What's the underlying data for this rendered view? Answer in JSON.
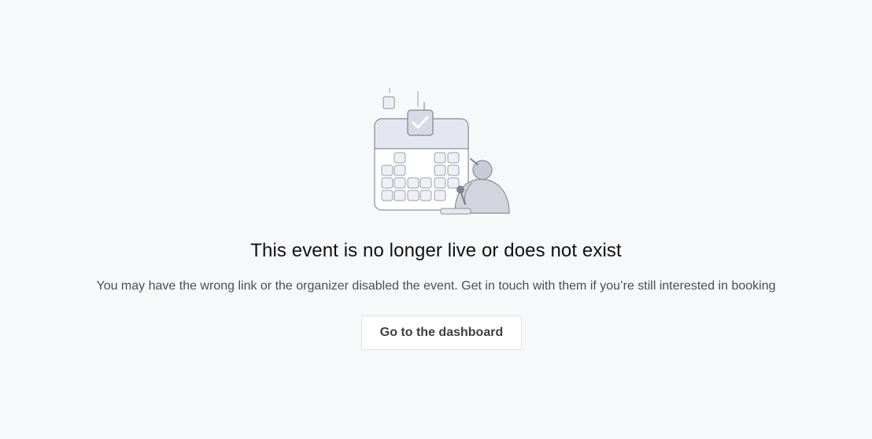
{
  "empty_state": {
    "illustration_icon": "calendar-check-illustration",
    "title": "This event is no longer live or does not exist",
    "message": "You may have the wrong link or the organizer disabled the event. Get in touch with them if you’re still interested in booking",
    "button_label": "Go to the dashboard"
  },
  "colors": {
    "background": "#f7f8fa",
    "title_text": "#111111",
    "body_text": "#4b4d52",
    "button_border": "#dfe1e6",
    "illustration_stroke": "#8b8f99",
    "illustration_fill": "#e6e8f0"
  }
}
